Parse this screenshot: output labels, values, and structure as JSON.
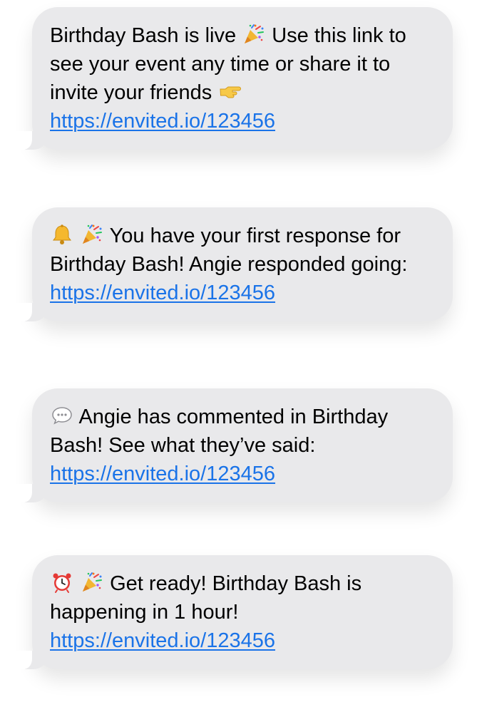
{
  "messages": [
    {
      "parts": [
        {
          "type": "text",
          "value": "Birthday Bash is live "
        },
        {
          "type": "icon",
          "icon": "party-popper-icon"
        },
        {
          "type": "text",
          "value": " Use this link to see your event any time or share it to invite your friends "
        },
        {
          "type": "icon",
          "icon": "pointing-right-icon"
        },
        {
          "type": "text",
          "value": " "
        },
        {
          "type": "link",
          "value": "https://envited.io/123456"
        }
      ]
    },
    {
      "parts": [
        {
          "type": "icon",
          "icon": "bell-icon"
        },
        {
          "type": "text",
          "value": " "
        },
        {
          "type": "icon",
          "icon": "party-popper-icon"
        },
        {
          "type": "text",
          "value": " You have your first response for Birthday Bash! Angie responded going: "
        },
        {
          "type": "link",
          "value": "https://envited.io/123456"
        }
      ]
    },
    {
      "parts": [
        {
          "type": "icon",
          "icon": "speech-bubble-icon"
        },
        {
          "type": "text",
          "value": " Angie has commented in Birthday Bash! See what they’ve said: "
        },
        {
          "type": "link",
          "value": "https://envited.io/123456"
        }
      ]
    },
    {
      "parts": [
        {
          "type": "icon",
          "icon": "alarm-clock-icon"
        },
        {
          "type": "text",
          "value": " "
        },
        {
          "type": "icon",
          "icon": "party-popper-icon"
        },
        {
          "type": "text",
          "value": " Get ready! Birthday Bash is happening in 1 hour! "
        },
        {
          "type": "link",
          "value": "https://envited.io/123456"
        }
      ]
    }
  ],
  "colors": {
    "bubble": "#e9e9eb",
    "text": "#000000",
    "link": "#1a73e8"
  }
}
